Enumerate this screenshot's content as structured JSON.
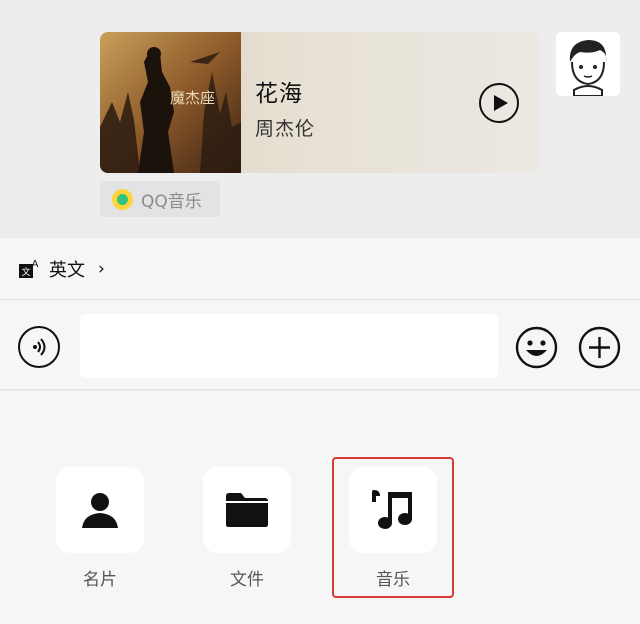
{
  "music_card": {
    "title": "花海",
    "artist": "周杰伦",
    "album_art_text": "魔杰座",
    "source": "QQ音乐"
  },
  "translate": {
    "label": "英文",
    "chevron": "›"
  },
  "input": {
    "value": "",
    "placeholder": ""
  },
  "tools": [
    {
      "label": "名片",
      "icon": "contact-card-icon"
    },
    {
      "label": "文件",
      "icon": "folder-icon"
    },
    {
      "label": "音乐",
      "icon": "music-note-icon"
    }
  ],
  "colors": {
    "background": "#ededed",
    "panel": "#f6f6f6",
    "highlight": "#d93a35",
    "qq_yellow": "#ffd43b",
    "qq_green": "#31c27c"
  }
}
